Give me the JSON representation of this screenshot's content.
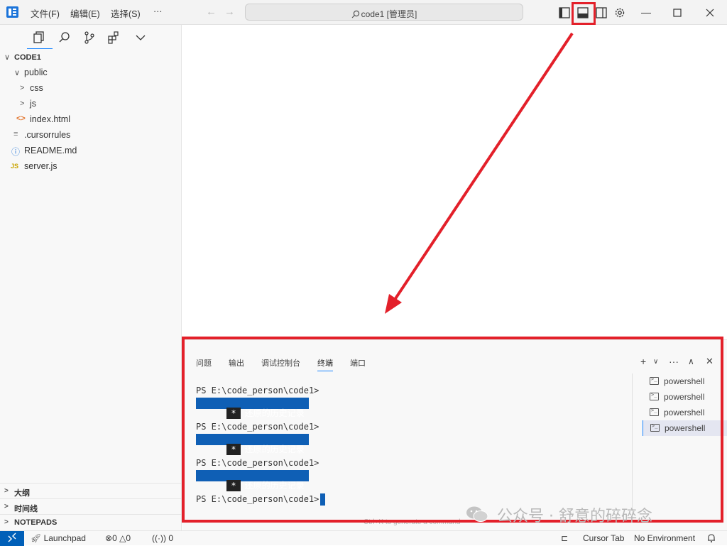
{
  "titlebar": {
    "menus": [
      "文件(F)",
      "编辑(E)",
      "选择(S)",
      "···"
    ],
    "back": "←",
    "forward": "→",
    "command_center": "code1 [管理员]"
  },
  "sidebar": {
    "root": "CODE1",
    "tree": [
      {
        "label": "public",
        "chev": "∨"
      },
      {
        "label": "css",
        "chev": ">"
      },
      {
        "label": "js",
        "chev": ">"
      },
      {
        "label": "index.html",
        "icon": "<>"
      },
      {
        "label": ".cursorrules",
        "icon": "≡"
      },
      {
        "label": "README.md",
        "icon": "ⓘ"
      },
      {
        "label": "server.js",
        "icon": "JS"
      }
    ],
    "sections": [
      "大纲",
      "时间线",
      "NOTEPADS"
    ]
  },
  "panel": {
    "tabs": [
      "问题",
      "输出",
      "调试控制台",
      "终端",
      "端口"
    ],
    "active_tab": "终端",
    "prompt": "PS E:\\code_person\\code1>",
    "history_star": "*",
    "history_text": "还原的历史记录",
    "terminals": [
      "powershell",
      "powershell",
      "powershell",
      "powershell"
    ]
  },
  "statusbar": {
    "launchpad": "Launchpad",
    "errors": "0",
    "warnings": "0",
    "ports": "0",
    "cursor_tab": "Cursor Tab",
    "environment": "No Environment"
  },
  "hint": "Ctrl+K to generate a command",
  "watermark": "公众号 · 舒意的碎碎念",
  "colors": {
    "accent": "#005fb8",
    "highlight_red": "#e3202a",
    "history_bg": "#0f5fb5"
  }
}
